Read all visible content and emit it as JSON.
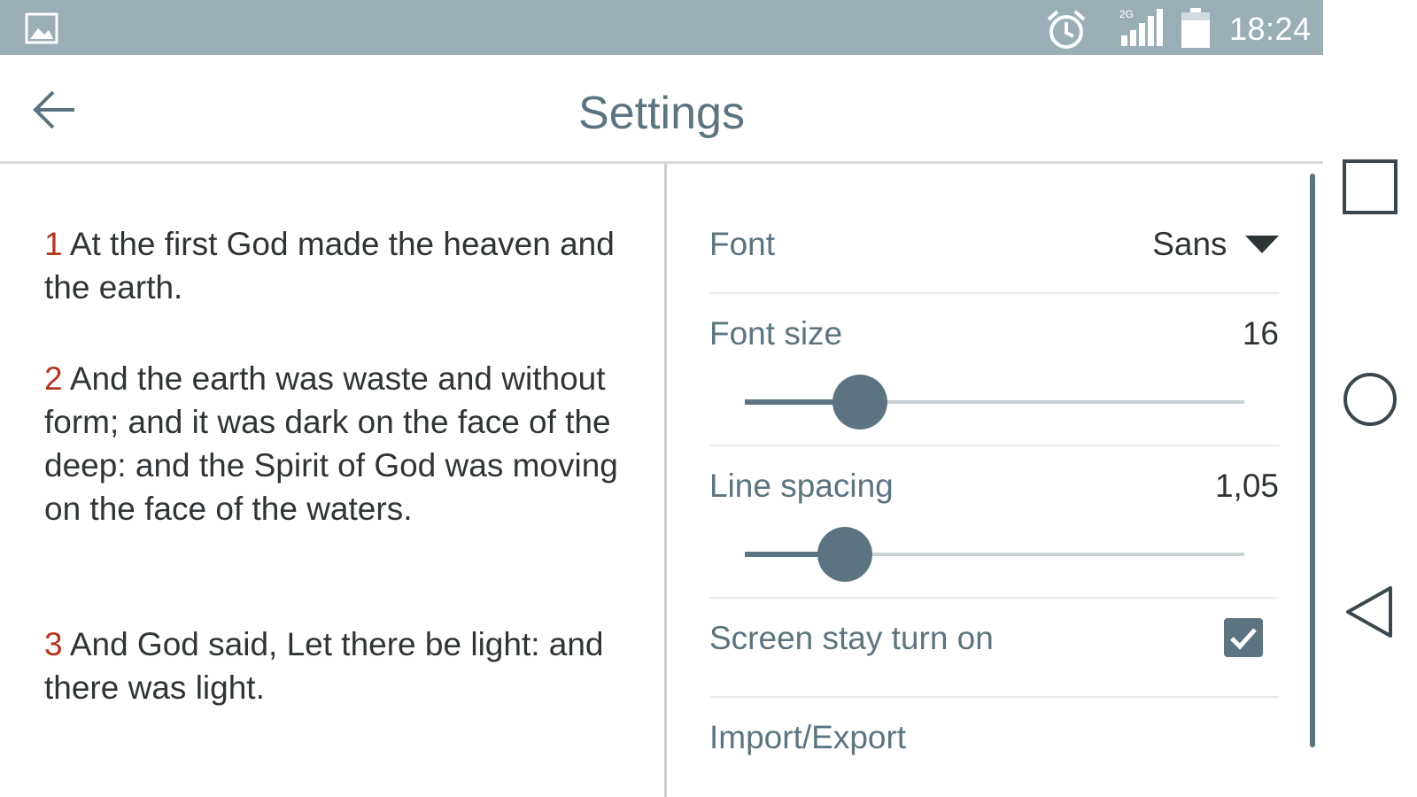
{
  "status_bar": {
    "time": "18:24",
    "network_label": "2G",
    "icons": [
      "gallery-icon",
      "alarm-clock-icon",
      "signal-icon",
      "battery-icon"
    ]
  },
  "app_bar": {
    "title": "Settings",
    "back_icon": "arrow-left-icon"
  },
  "reading": {
    "verses": [
      {
        "number": "1",
        "text": " At the first God made the heaven and the earth."
      },
      {
        "number": "2",
        "text": " And the earth was waste and without form; and it was dark on the face of the deep: and the Spirit of God was moving on the face of the waters."
      },
      {
        "number": "3",
        "text": " And God said, Let there be light: and there was light."
      }
    ]
  },
  "settings": {
    "font": {
      "label": "Font",
      "value": "Sans"
    },
    "font_size": {
      "label": "Font size",
      "value": "16",
      "slider_percent": 23
    },
    "line_spacing": {
      "label": "Line spacing",
      "value": "1,05",
      "slider_percent": 20
    },
    "screen_on": {
      "label": "Screen stay turn on",
      "checked": true
    },
    "import_export": {
      "label": "Import/Export"
    }
  },
  "nav_bar": {
    "icons": [
      "recent-apps-icon",
      "home-icon",
      "back-icon"
    ]
  },
  "colors": {
    "accent": "#5c7480",
    "status_bar": "#9aaeb6",
    "verse_number": "#b3361f",
    "text": "#2f3436"
  }
}
